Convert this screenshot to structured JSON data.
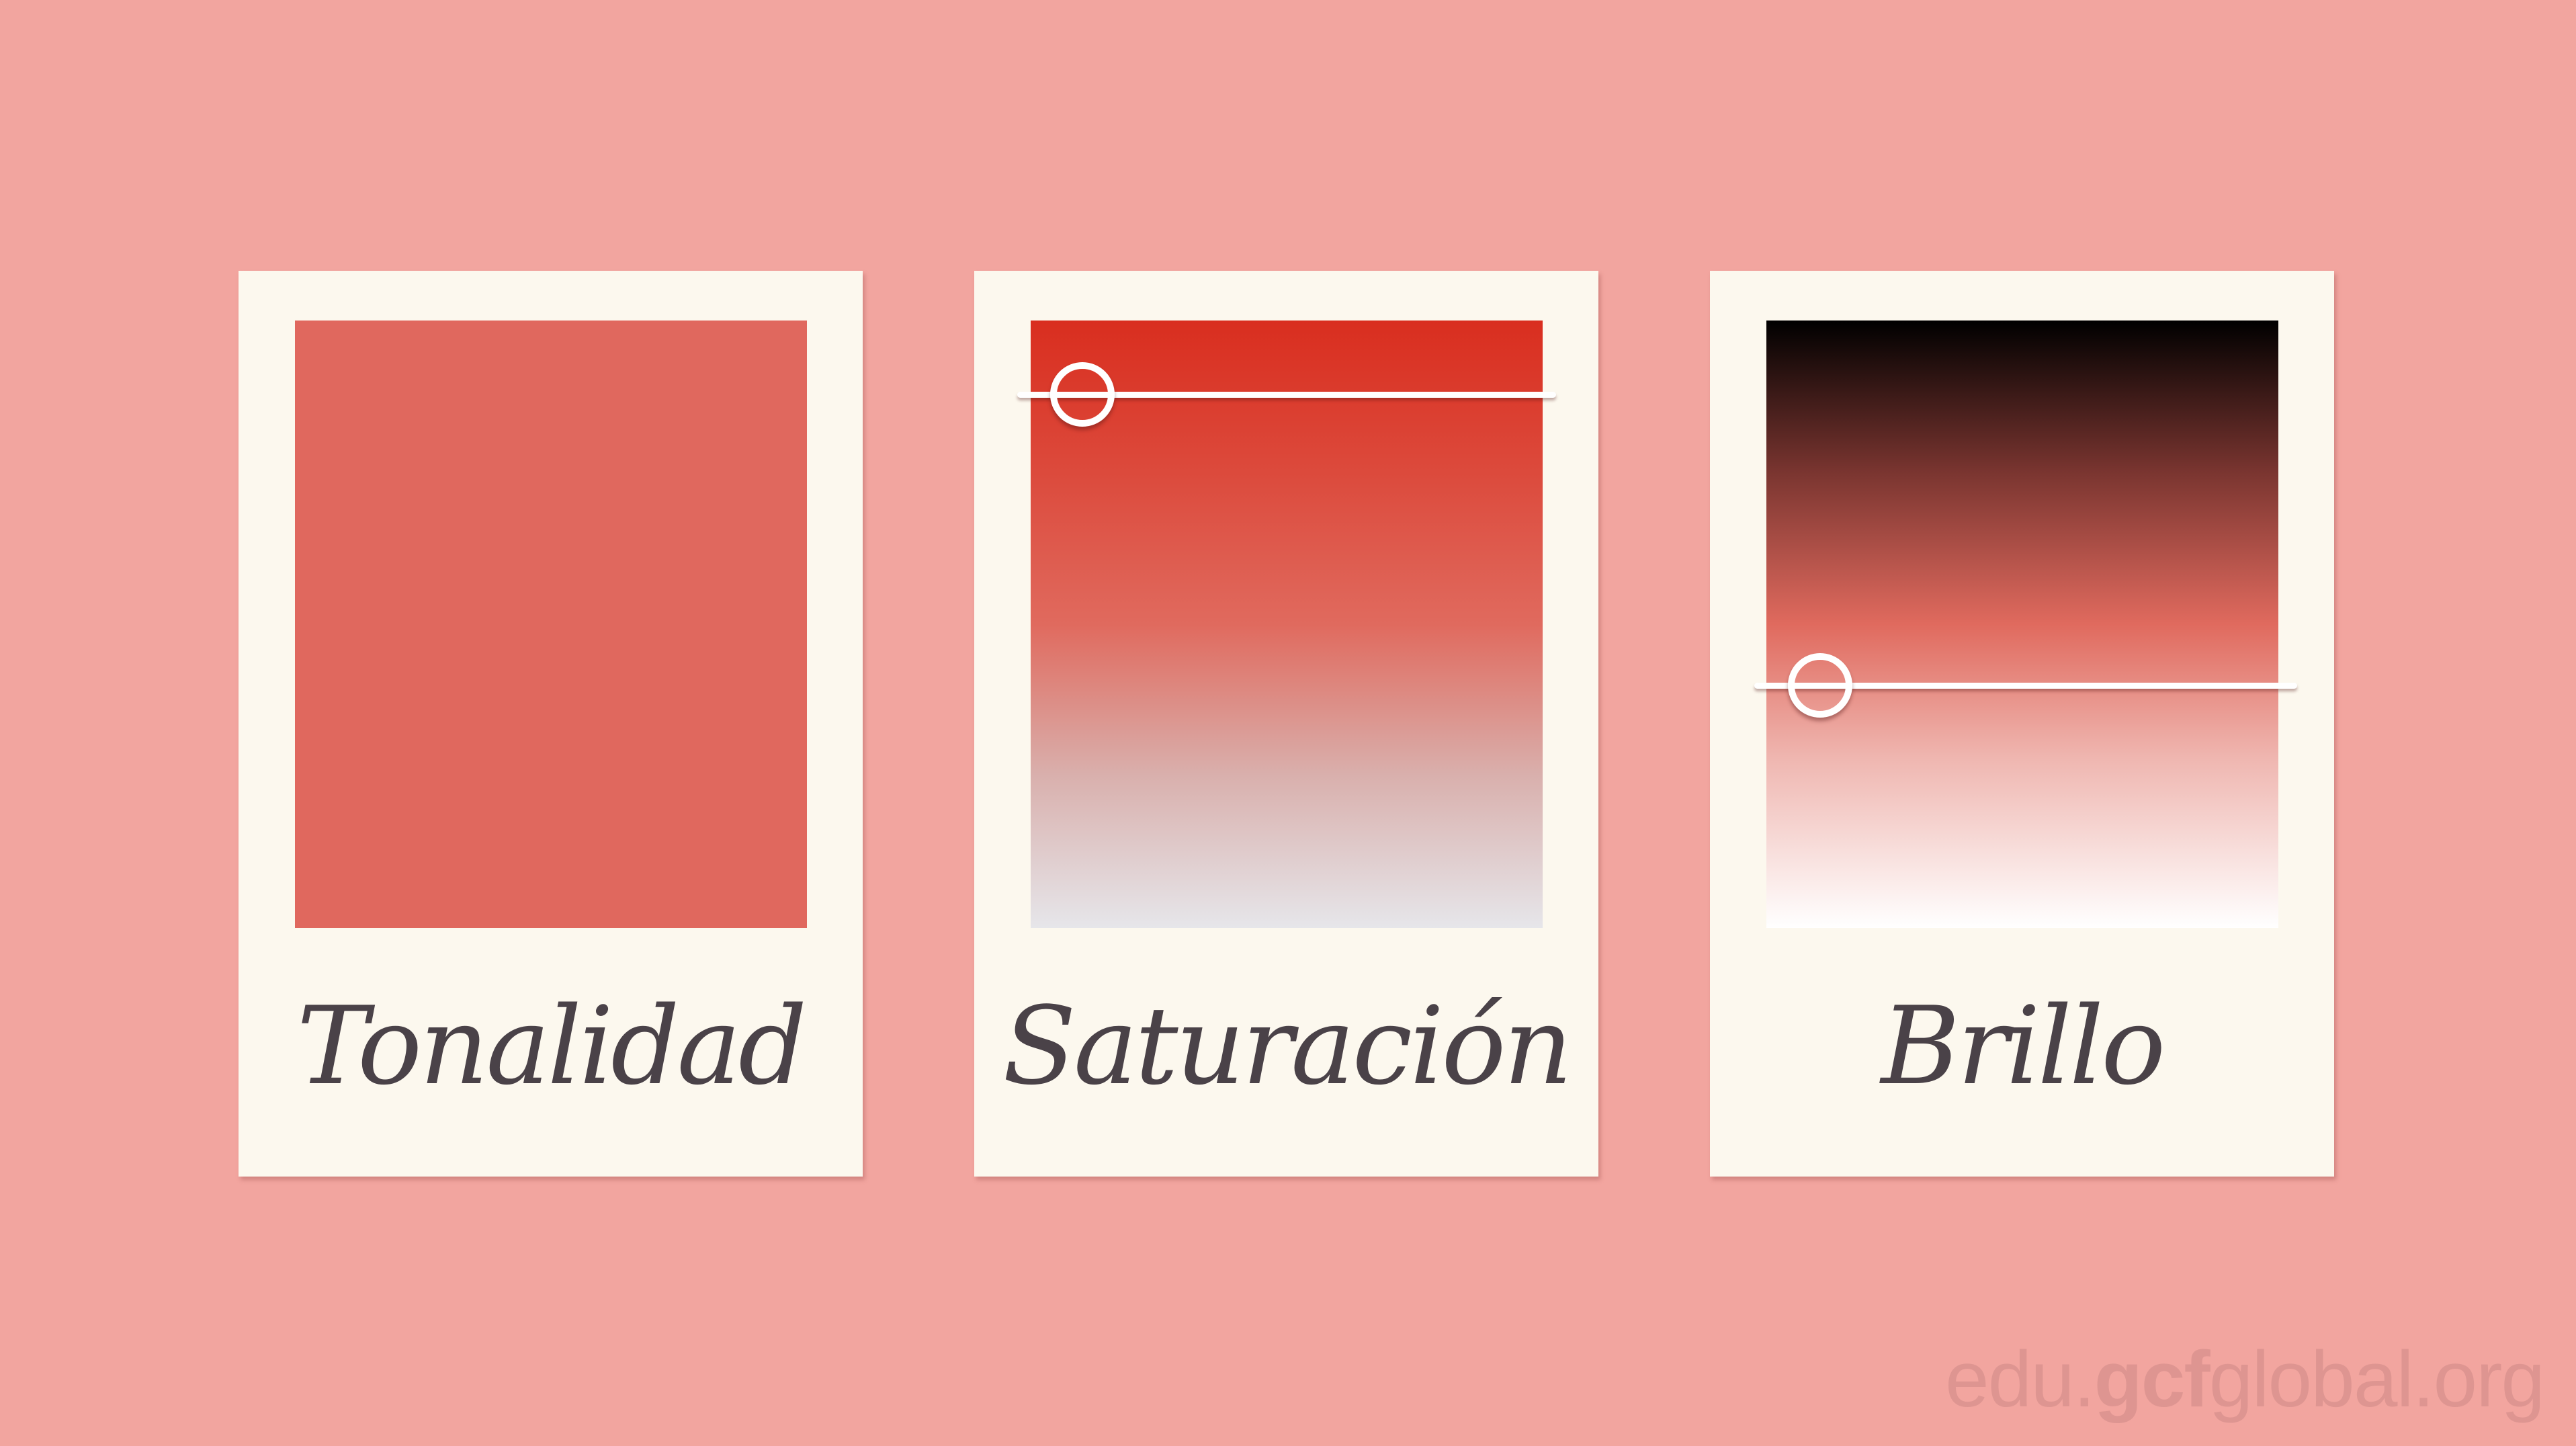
{
  "background_color": "#f2a59f",
  "cards": [
    {
      "label": "Tonalidad",
      "swatch_color": "#e0685e"
    },
    {
      "label": "Saturación",
      "gradient": [
        "#d92e1f",
        "#e06a5e",
        "#e6e6ea"
      ],
      "slider_value": 0.1
    },
    {
      "label": "Brillo",
      "gradient": [
        "#000000",
        "#e06a5e",
        "#ffffff"
      ],
      "slider_value": 0.11
    }
  ],
  "watermark": {
    "prefix": "edu.",
    "brand": "gcf",
    "suffix": "global.org"
  }
}
